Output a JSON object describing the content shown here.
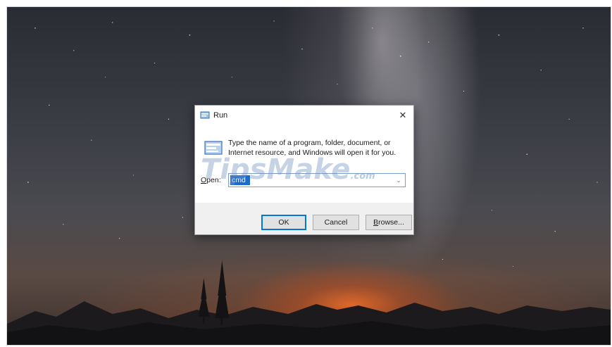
{
  "run_dialog": {
    "title": "Run",
    "close_glyph": "✕",
    "description": "Type the name of a program, folder, document, or Internet resource, and Windows will open it for you.",
    "open_label_first": "O",
    "open_label_rest": "pen:",
    "open_value": "cmd",
    "buttons": {
      "ok": "OK",
      "cancel": "Cancel",
      "browse_first": "B",
      "browse_rest": "rowse..."
    }
  },
  "watermark": {
    "text": "TipsMake",
    "suffix": ".com"
  },
  "icons": {
    "app": "run-icon",
    "close": "close-icon",
    "dropdown": "chevron-down-icon"
  },
  "colors": {
    "selection": "#1c6ad0",
    "focus_border": "#0078d7"
  }
}
